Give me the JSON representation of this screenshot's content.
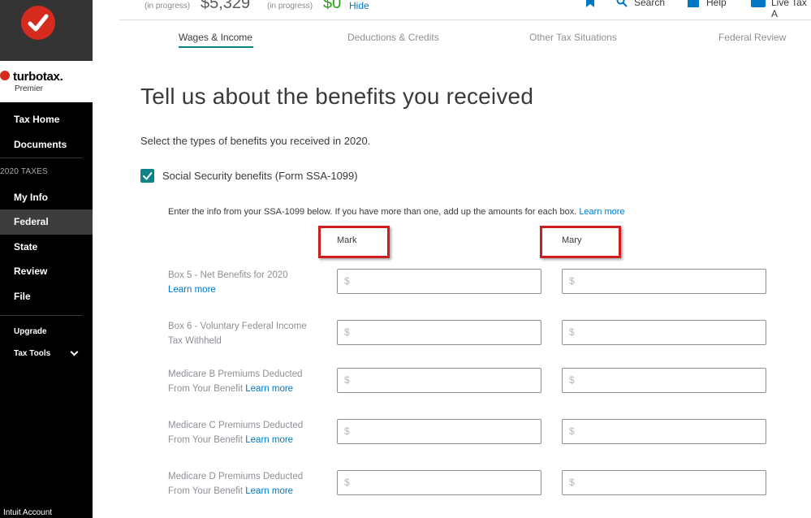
{
  "sidebar": {
    "brand": "turbotax.",
    "edition": "Premier",
    "items": [
      {
        "label": "Tax Home"
      },
      {
        "label": "Documents"
      },
      {
        "label": "My Info"
      },
      {
        "label": "Federal"
      },
      {
        "label": "State"
      },
      {
        "label": "Review"
      },
      {
        "label": "File"
      }
    ],
    "section_label": "2020 TAXES",
    "upgrade": "Upgrade",
    "tax_tools": "Tax Tools",
    "account": "Intuit Account"
  },
  "topbar": {
    "federal_status": "(in progress)",
    "federal_amount": "$5,329",
    "state_status": "(in progress)",
    "state_amount": "$0",
    "hide": "Hide",
    "search": "Search",
    "help": "Help",
    "live": "Live Tax A"
  },
  "tabs": [
    {
      "label": "Wages & Income"
    },
    {
      "label": "Deductions & Credits"
    },
    {
      "label": "Other Tax Situations"
    },
    {
      "label": "Federal Review"
    }
  ],
  "main": {
    "title": "Tell us about the benefits you received",
    "intro": "Select the types of benefits you received in 2020.",
    "checkbox_label": "Social Security benefits (Form SSA-1099)",
    "instructions": "Enter the info from your SSA-1099 below. If you have more than one, add up the amounts for each box.",
    "learn_more": "Learn more",
    "columns": [
      "Mark",
      "Mary"
    ],
    "rows": [
      {
        "line1": "Box 5 - Net Benefits for 2020",
        "line2": "",
        "link": "Learn more"
      },
      {
        "line1": "Box 6 - Voluntary Federal Income",
        "line2": "Tax Withheld",
        "link": ""
      },
      {
        "line1": "Medicare B Premiums Deducted",
        "line2": "From Your Benefit",
        "link": "Learn more"
      },
      {
        "line1": "Medicare C Premiums Deducted",
        "line2": "From Your Benefit",
        "link": "Learn more"
      },
      {
        "line1": "Medicare D Premiums Deducted",
        "line2": "From Your Benefit",
        "link": "Learn more"
      }
    ],
    "currency_placeholder": "$"
  },
  "colors": {
    "accent": "#0c8489",
    "link": "#0077c5",
    "highlight": "#cc1e1e",
    "brand_red": "#d52b1e"
  }
}
